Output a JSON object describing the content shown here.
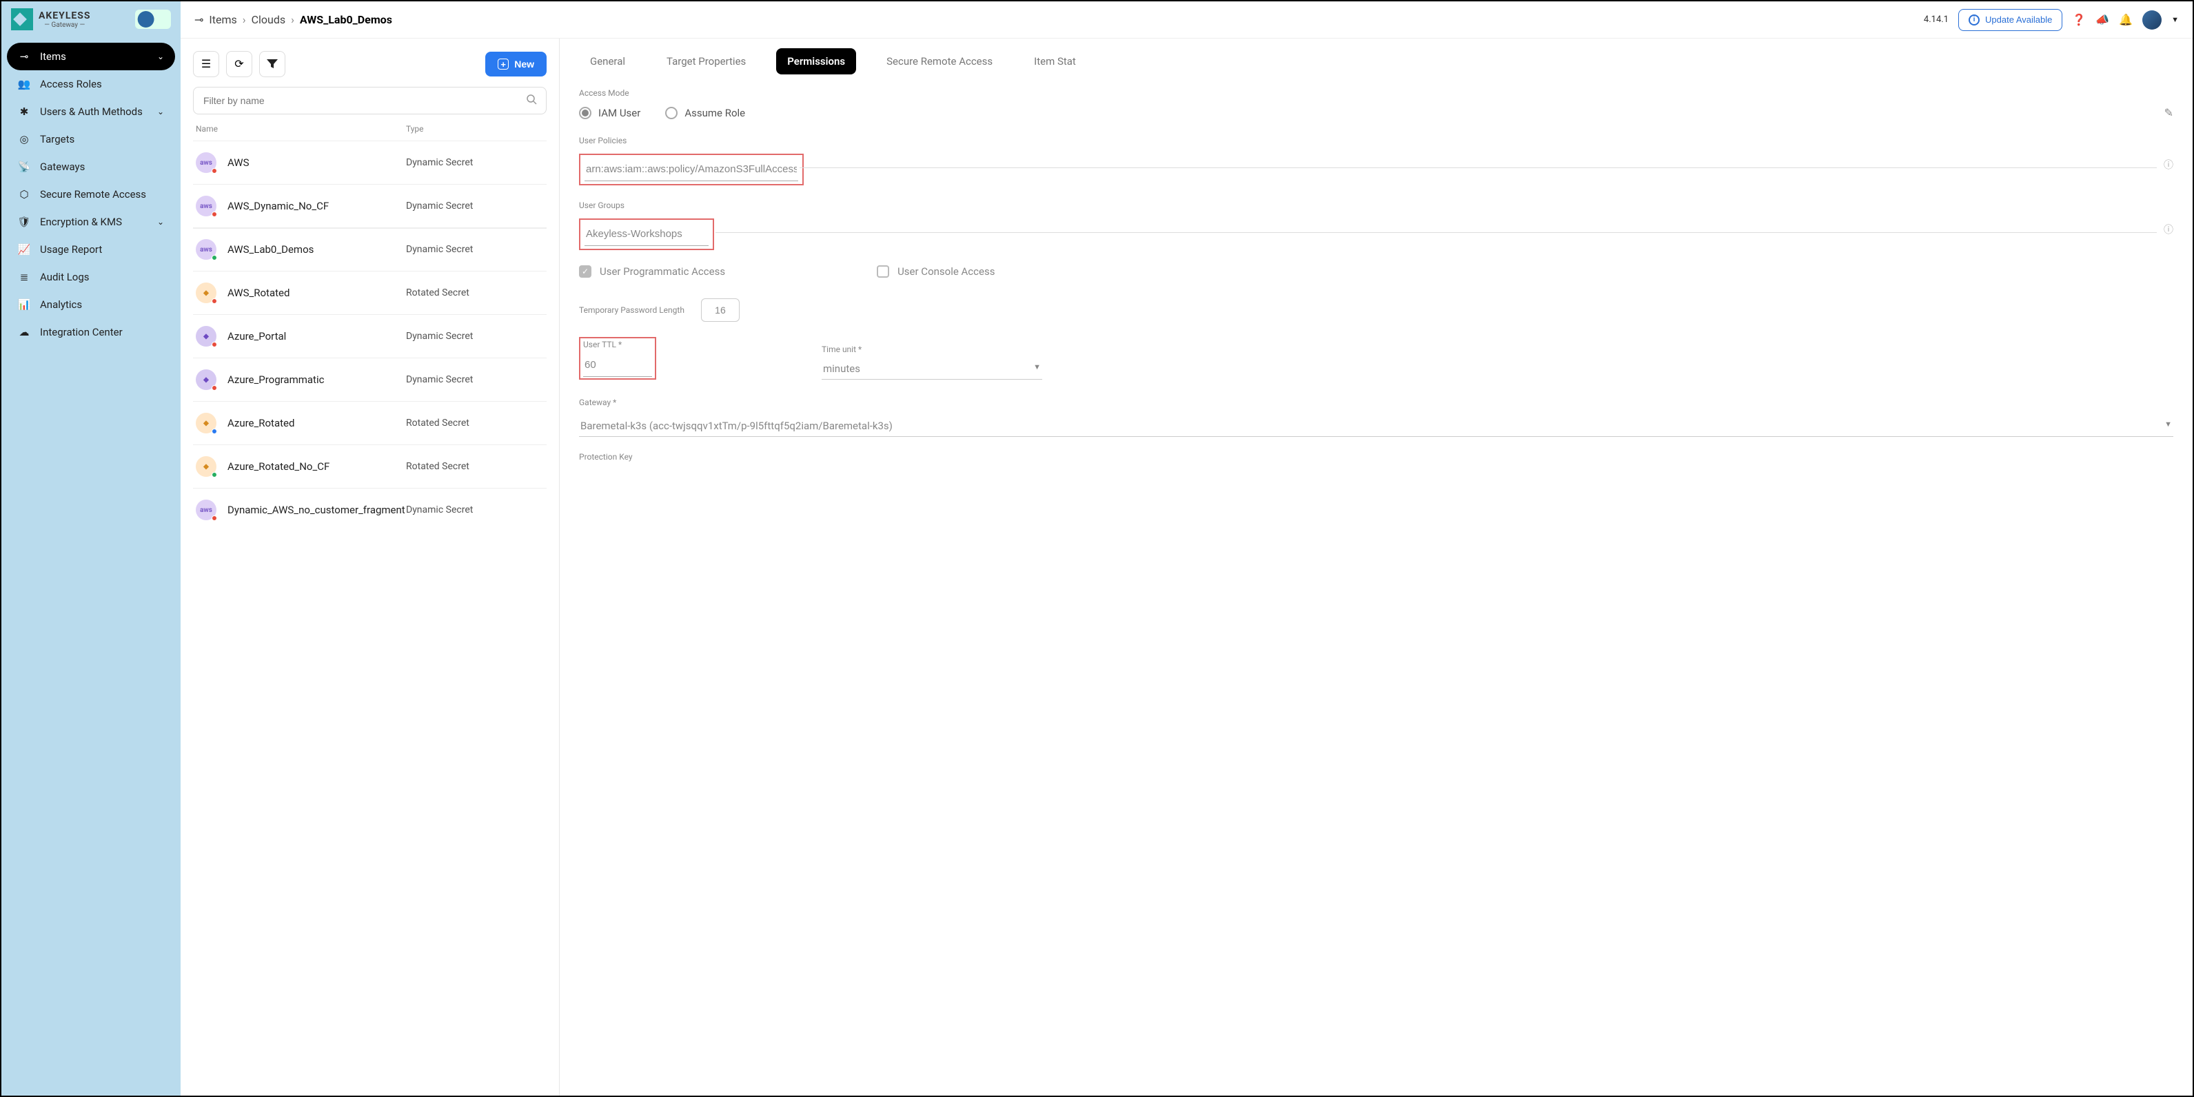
{
  "logo": {
    "brand": "AKEYLESS",
    "sub": "— Gateway —"
  },
  "sidebar": {
    "items": [
      {
        "label": "Items",
        "icon": "⊸",
        "active": true,
        "chevron": true
      },
      {
        "label": "Access Roles",
        "icon": "👥"
      },
      {
        "label": "Users & Auth Methods",
        "icon": "✱",
        "chevron": true
      },
      {
        "label": "Targets",
        "icon": "◎"
      },
      {
        "label": "Gateways",
        "icon": "📡"
      },
      {
        "label": "Secure Remote Access",
        "icon": "⬡"
      },
      {
        "label": "Encryption & KMS",
        "icon": "🛡",
        "chevron": true
      },
      {
        "label": "Usage Report",
        "icon": "📈"
      },
      {
        "label": "Audit Logs",
        "icon": "≣"
      },
      {
        "label": "Analytics",
        "icon": "📊"
      },
      {
        "label": "Integration Center",
        "icon": "☁"
      }
    ]
  },
  "topbar": {
    "breadcrumb": [
      "Items",
      "Clouds",
      "AWS_Lab0_Demos"
    ],
    "version": "4.14.1",
    "update": "Update Available"
  },
  "list": {
    "new_label": "New",
    "filter_placeholder": "Filter by name",
    "headers": {
      "name": "Name",
      "type": "Type"
    },
    "rows": [
      {
        "name": "AWS",
        "type": "Dynamic Secret",
        "icon": "aws",
        "dot": "red"
      },
      {
        "name": "AWS_Dynamic_No_CF",
        "type": "Dynamic Secret",
        "icon": "aws",
        "dot": "red"
      },
      {
        "name": "AWS_Lab0_Demos",
        "type": "Dynamic Secret",
        "icon": "aws",
        "dot": "green",
        "selected": true
      },
      {
        "name": "AWS_Rotated",
        "type": "Rotated Secret",
        "icon": "az-rot",
        "dot": "red"
      },
      {
        "name": "Azure_Portal",
        "type": "Dynamic Secret",
        "icon": "azure",
        "dot": "red"
      },
      {
        "name": "Azure_Programmatic",
        "type": "Dynamic Secret",
        "icon": "azure",
        "dot": "red"
      },
      {
        "name": "Azure_Rotated",
        "type": "Rotated Secret",
        "icon": "az-rot",
        "dot": "blue"
      },
      {
        "name": "Azure_Rotated_No_CF",
        "type": "Rotated Secret",
        "icon": "az-rot",
        "dot": "green"
      },
      {
        "name": "Dynamic_AWS_no_customer_fragment",
        "type": "Dynamic Secret",
        "icon": "aws",
        "dot": "red"
      }
    ]
  },
  "detail": {
    "tabs": [
      "General",
      "Target Properties",
      "Permissions",
      "Secure Remote Access",
      "Item Stat"
    ],
    "active_tab": "Permissions",
    "access_mode_label": "Access Mode",
    "iam_user": "IAM User",
    "assume_role": "Assume Role",
    "user_policies_label": "User Policies",
    "user_policies_value": "arn:aws:iam::aws:policy/AmazonS3FullAccess",
    "user_groups_label": "User Groups",
    "user_groups_value": "Akeyless-Workshops",
    "prog_access": "User Programmatic Access",
    "console_access": "User Console Access",
    "temp_pw_label": "Temporary Password Length",
    "temp_pw_value": "16",
    "user_ttl_label": "User TTL *",
    "user_ttl_value": "60",
    "time_unit_label": "Time unit *",
    "time_unit_value": "minutes",
    "gateway_label": "Gateway *",
    "gateway_value": "Baremetal-k3s (acc-twjsqqv1xtTm/p-9l5fttqf5q2iam/Baremetal-k3s)",
    "protection_label": "Protection Key"
  }
}
